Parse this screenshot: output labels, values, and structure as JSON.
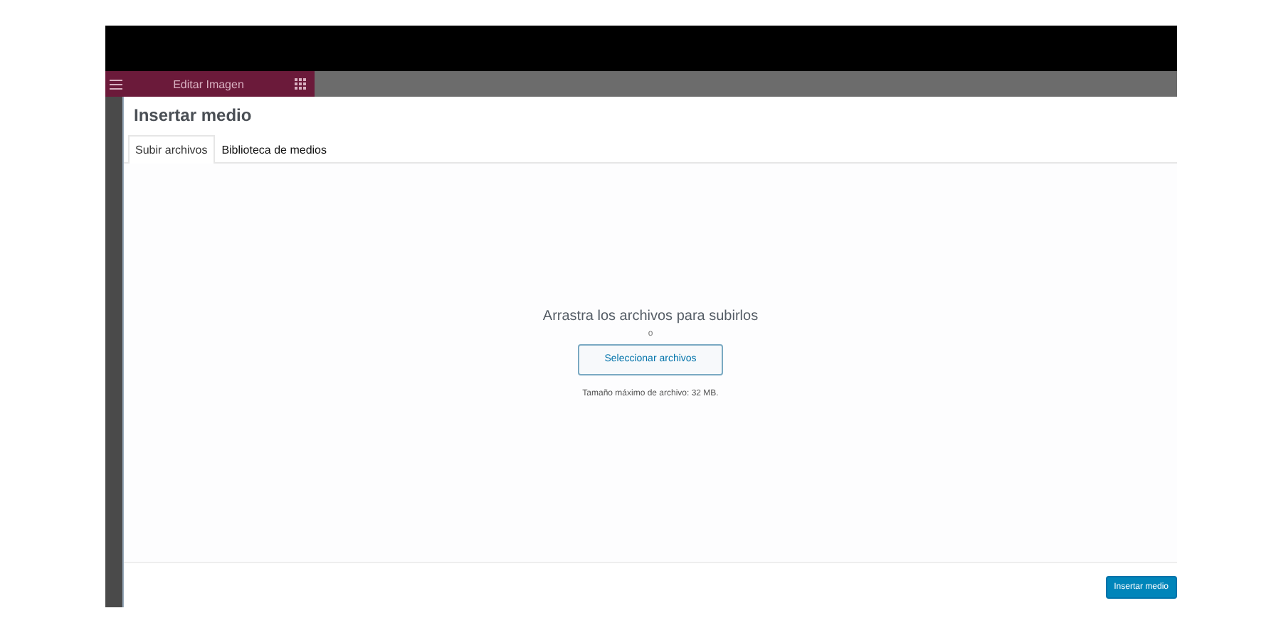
{
  "editor": {
    "panel_title": "Editar Imagen"
  },
  "modal": {
    "title": "Insertar medio",
    "tabs": [
      {
        "label": "Subir archivos",
        "selected": true
      },
      {
        "label": "Biblioteca de medios",
        "selected": false
      }
    ],
    "upload": {
      "instructions": "Arrastra los archivos para subirlos",
      "separator": "o",
      "button": "Seleccionar archivos",
      "max_size": "Tamaño máximo de archivo: 32 MB."
    },
    "primary_button": "Insertar medio"
  }
}
